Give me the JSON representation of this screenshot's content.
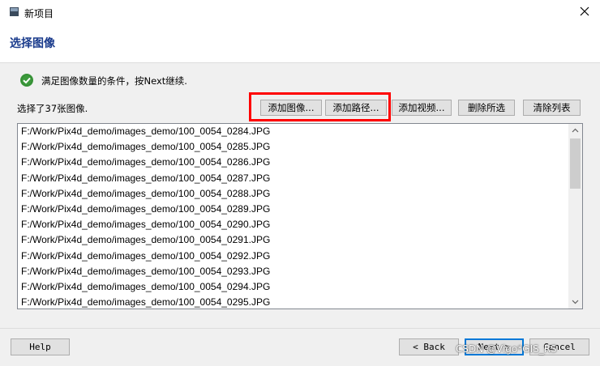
{
  "window": {
    "title": "新项目"
  },
  "header": {
    "heading": "选择图像"
  },
  "status": {
    "message": "满足图像数量的条件，按Next继续."
  },
  "images": {
    "count_label": "选择了37张图像.",
    "items": [
      "F:/Work/Pix4d_demo/images_demo/100_0054_0284.JPG",
      "F:/Work/Pix4d_demo/images_demo/100_0054_0285.JPG",
      "F:/Work/Pix4d_demo/images_demo/100_0054_0286.JPG",
      "F:/Work/Pix4d_demo/images_demo/100_0054_0287.JPG",
      "F:/Work/Pix4d_demo/images_demo/100_0054_0288.JPG",
      "F:/Work/Pix4d_demo/images_demo/100_0054_0289.JPG",
      "F:/Work/Pix4d_demo/images_demo/100_0054_0290.JPG",
      "F:/Work/Pix4d_demo/images_demo/100_0054_0291.JPG",
      "F:/Work/Pix4d_demo/images_demo/100_0054_0292.JPG",
      "F:/Work/Pix4d_demo/images_demo/100_0054_0293.JPG",
      "F:/Work/Pix4d_demo/images_demo/100_0054_0294.JPG",
      "F:/Work/Pix4d_demo/images_demo/100_0054_0295.JPG"
    ]
  },
  "toolbar": {
    "add_images": "添加图像...",
    "add_path": "添加路径...",
    "add_video": "添加视频...",
    "remove_selected": "删除所选",
    "clear_list": "清除列表"
  },
  "footer": {
    "help": "Help",
    "back": "< Back",
    "next": "Next >",
    "cancel": "Cancel"
  },
  "watermark": "CSDN @Vigo*GIS_RS",
  "colors": {
    "heading": "#1a3b8c",
    "highlight": "#ff0000",
    "ok": "#3c9a3c"
  }
}
